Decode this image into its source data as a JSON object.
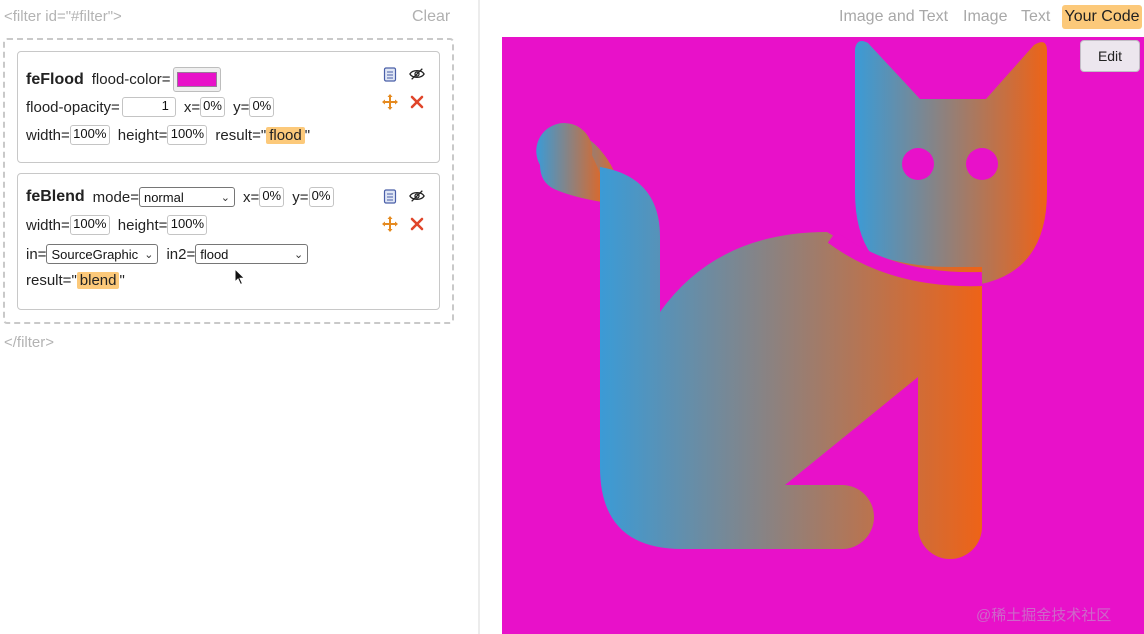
{
  "editor": {
    "filter_open": "<filter id=\"#filter\">",
    "filter_close": "</filter>",
    "clear": "Clear"
  },
  "flood": {
    "name": "feFlood",
    "color_label": "flood-color=",
    "color_value": "#e811c9",
    "opacity_label": "flood-opacity=",
    "opacity_value": "1",
    "x_label": "x=",
    "x_value": "0%",
    "y_label": "y=",
    "y_value": "0%",
    "width_label": "width=",
    "width_value": "100%",
    "height_label": "height=",
    "height_value": "100%",
    "result_label": "result=\"",
    "result_value": "flood",
    "result_close": "\""
  },
  "blend": {
    "name": "feBlend",
    "mode_label": "mode=",
    "mode_value": "normal",
    "x_label": "x=",
    "x_value": "0%",
    "y_label": "y=",
    "y_value": "0%",
    "width_label": "width=",
    "width_value": "100%",
    "height_label": "height=",
    "height_value": "100%",
    "in_label": "in=",
    "in_value": "SourceGraphic",
    "in2_label": "in2=",
    "in2_value": "flood",
    "result_label": "result=\"",
    "result_value": "blend",
    "result_close": "\""
  },
  "tabs": {
    "image_and_text": "Image and Text",
    "image": "Image",
    "text": "Text",
    "your_code": "Your Code"
  },
  "preview": {
    "edit": "Edit",
    "background_color": "#e811c9",
    "gradient_start": "#3b9bd6",
    "gradient_end": "#ee6317"
  },
  "watermark": "@稀土掘金技术社区"
}
